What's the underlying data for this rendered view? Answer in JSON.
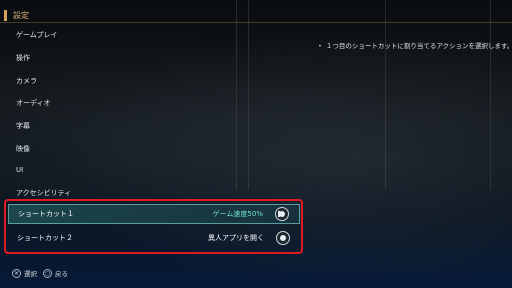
{
  "header": {
    "title": "設定"
  },
  "menu": {
    "items": [
      {
        "label": "ゲームプレイ"
      },
      {
        "label": "操作"
      },
      {
        "label": "カメラ"
      },
      {
        "label": "オーディオ"
      },
      {
        "label": "字幕"
      },
      {
        "label": "映像"
      },
      {
        "label": "UI"
      },
      {
        "label": "アクセシビリティ"
      }
    ]
  },
  "description": {
    "bullet": "•",
    "text": "１つ目のショートカットに割り当てるアクションを選択します。"
  },
  "shortcuts": [
    {
      "label": "ショートカット１",
      "value": "ゲーム速度50%",
      "icon": "stick-button-icon"
    },
    {
      "label": "ショートカット２",
      "value": "異人アプリを開く",
      "icon": "stick-button-icon"
    }
  ],
  "footer": {
    "select_glyph": "✕",
    "select_label": "選択",
    "back_glyph": "○",
    "back_label": "戻る"
  },
  "colors": {
    "accent": "#e0b27a",
    "selected_value": "#6fe0d4",
    "highlight_frame": "#e01a24"
  }
}
